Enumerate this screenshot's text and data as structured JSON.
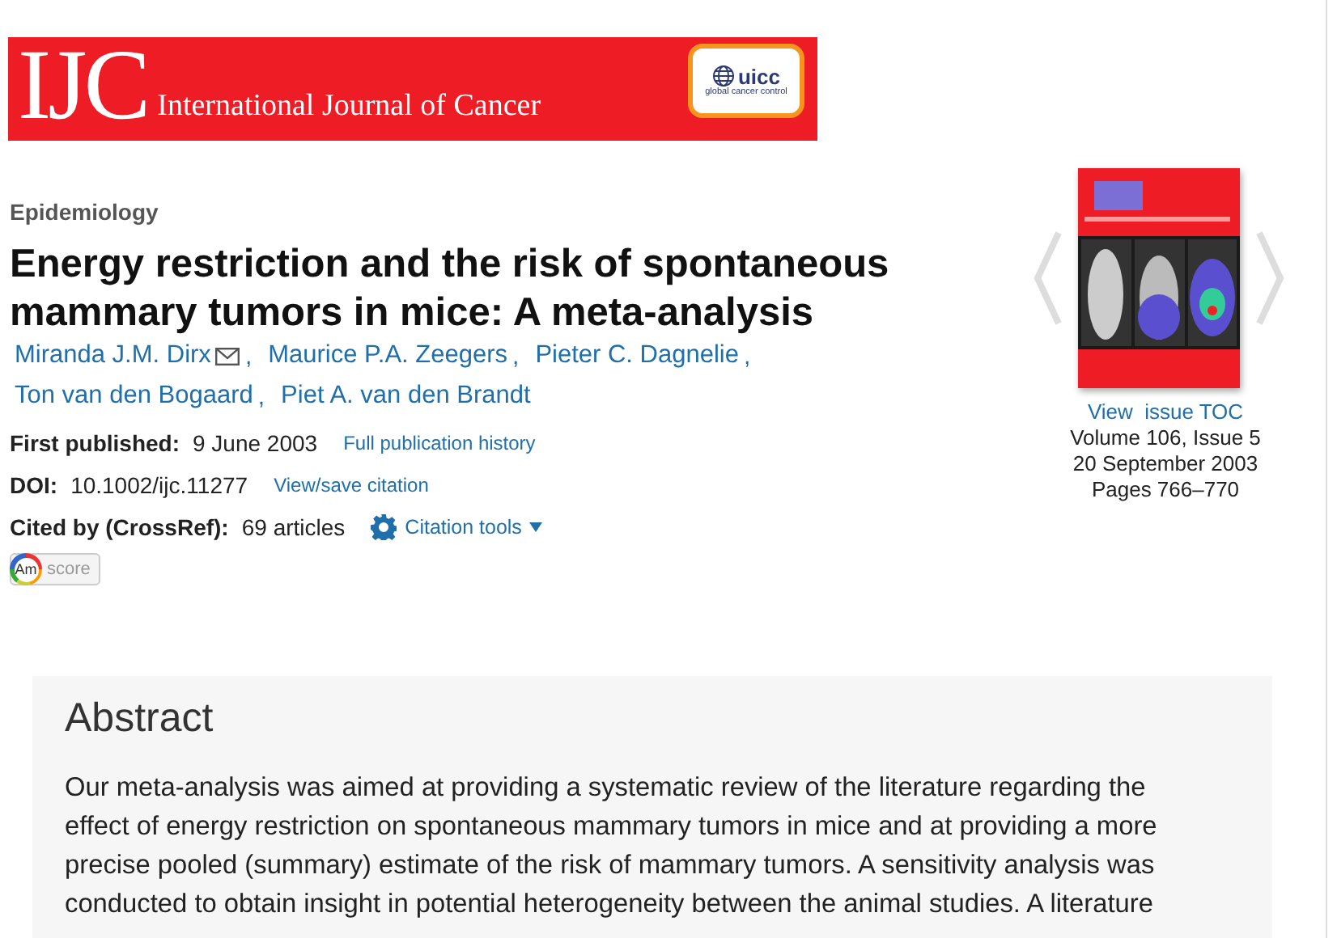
{
  "header": {
    "logo_mark": "IJC",
    "logo_title": "International Journal of Cancer",
    "partner": {
      "name": "uicc",
      "tagline": "global cancer control"
    }
  },
  "article": {
    "section": "Epidemiology",
    "title": "Energy restriction and the risk of spontaneous mammary tumors in mice: A meta-analysis",
    "authors": [
      {
        "name": "Miranda J.M. Dirx",
        "email": true,
        "separator": ","
      },
      {
        "name": "Maurice P.A. Zeegers",
        "email": false,
        "separator": ","
      },
      {
        "name": "Pieter C. Dagnelie",
        "email": false,
        "separator": ","
      },
      {
        "name": "Ton van den Bogaard",
        "email": false,
        "separator": ","
      },
      {
        "name": "Piet A. van den Brandt",
        "email": false
      }
    ],
    "meta": [
      {
        "label": "First published:",
        "value": "9 June 2003",
        "link": "Full publication history",
        "kind": "link"
      },
      {
        "label": "DOI:",
        "value": "10.1002/ijc.11277",
        "link": "View/save citation",
        "kind": "link"
      },
      {
        "label": "Cited by (CrossRef):",
        "value": "69 articles",
        "link": "Citation tools",
        "kind": "tools"
      }
    ],
    "altmetric": {
      "mark": "Am",
      "label": "score"
    }
  },
  "issue": {
    "toc_link": "View  issue TOC",
    "lines": [
      "Volume 106, Issue 5",
      "20 September 2003",
      "Pages 766–770"
    ]
  },
  "abstract": {
    "heading": "Abstract",
    "text": "Our meta-analysis was aimed at providing a systematic review of the literature regarding the effect of energy restriction on spontaneous mammary tumors in mice and at providing a more precise pooled (summary) estimate of the risk of mammary tumors. A sensitivity analysis was conducted to obtain insight in potential heterogeneity between the animal studies. A literature"
  }
}
